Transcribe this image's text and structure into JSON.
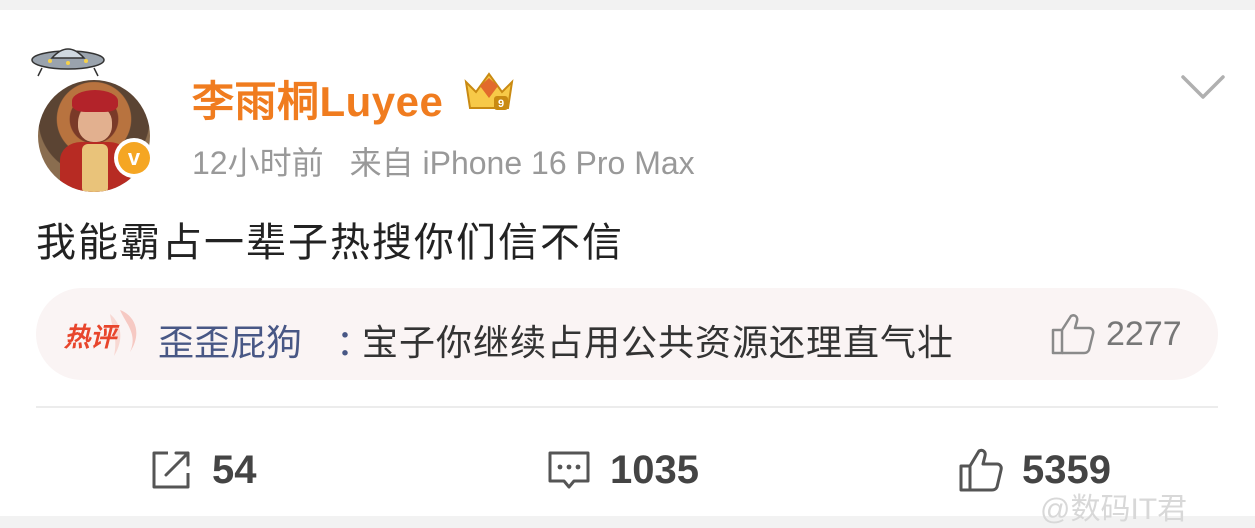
{
  "post": {
    "username": "李雨桐Luyee",
    "time": "12小时前",
    "source": "来自 iPhone 16 Pro Max",
    "text": "我能霸占一辈子热搜你们信不信",
    "verified_mark": "v"
  },
  "hot_comment": {
    "tag": "热评",
    "commenter": "歪歪屁狗",
    "colon": "：",
    "text": "宝子你继续占用公共资源还理直气壮",
    "likes": "2277"
  },
  "actions": {
    "repost_count": "54",
    "comment_count": "1035",
    "like_count": "5359"
  },
  "watermark": "@数码IT君",
  "colors": {
    "username": "#f07c1f",
    "commenter": "#485785",
    "verified_badge": "#f5a623",
    "hot_tag": "#e8452c"
  },
  "icons": {
    "ufo_badge": "ufo-icon",
    "crown_badge": "crown-level-icon",
    "more": "chevron-down-icon",
    "hot_comment_like": "thumbs-up-icon",
    "repost": "share-icon",
    "comment": "comment-icon",
    "like": "thumbs-up-icon"
  }
}
